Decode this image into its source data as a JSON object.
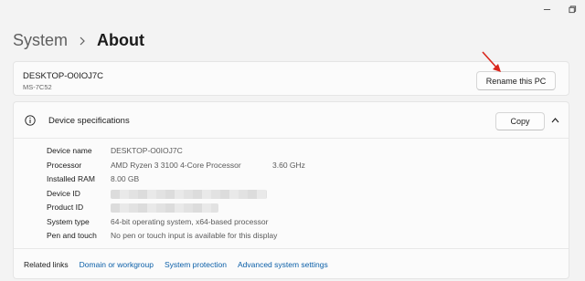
{
  "breadcrumb": {
    "parent": "System",
    "current": "About"
  },
  "pc": {
    "name": "DESKTOP-O0IOJ7C",
    "model": "MS-7C52",
    "rename_label": "Rename this PC"
  },
  "specs": {
    "title": "Device specifications",
    "copy_label": "Copy",
    "rows": [
      {
        "label": "Device name",
        "value": "DESKTOP-O0IOJ7C",
        "extra": ""
      },
      {
        "label": "Processor",
        "value": "AMD Ryzen 3 3100 4-Core Processor",
        "extra": "3.60 GHz"
      },
      {
        "label": "Installed RAM",
        "value": "8.00 GB",
        "extra": ""
      },
      {
        "label": "Device ID",
        "value": "",
        "extra": ""
      },
      {
        "label": "Product ID",
        "value": "",
        "extra": ""
      },
      {
        "label": "System type",
        "value": "64-bit operating system, x64-based processor",
        "extra": ""
      },
      {
        "label": "Pen and touch",
        "value": "No pen or touch input is available for this display",
        "extra": ""
      }
    ]
  },
  "related": {
    "title": "Related links",
    "links": [
      "Domain or workgroup",
      "System protection",
      "Advanced system settings"
    ]
  },
  "colors": {
    "link": "#0b5fa8",
    "arrow": "#d9261c"
  },
  "icons": [
    "minimize-icon",
    "maximize-icon",
    "chevron-right-icon",
    "info-icon",
    "chevron-up-icon",
    "arrow-annotation-icon"
  ]
}
